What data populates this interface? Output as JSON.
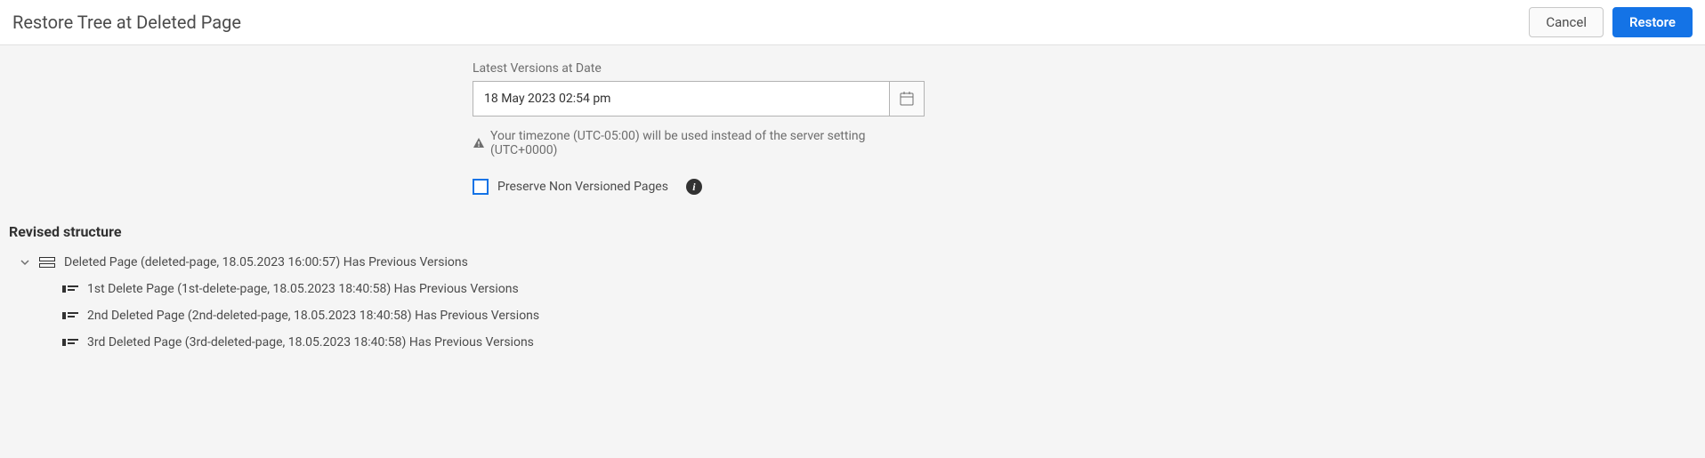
{
  "header": {
    "title": "Restore Tree at Deleted Page",
    "cancel_label": "Cancel",
    "restore_label": "Restore"
  },
  "form": {
    "date_label": "Latest Versions at Date",
    "date_value": "18 May 2023 02:54 pm",
    "timezone_note": "Your timezone (UTC-05:00) will be used instead of the server setting (UTC+0000)",
    "preserve_label": "Preserve Non Versioned Pages"
  },
  "section": {
    "title": "Revised structure"
  },
  "tree": {
    "root": {
      "label": "Deleted Page (deleted-page, 18.05.2023 16:00:57) Has Previous Versions"
    },
    "children": [
      {
        "label": "1st Delete Page (1st-delete-page, 18.05.2023 18:40:58) Has Previous Versions"
      },
      {
        "label": "2nd Deleted Page (2nd-deleted-page, 18.05.2023 18:40:58) Has Previous Versions"
      },
      {
        "label": "3rd Deleted Page (3rd-deleted-page, 18.05.2023 18:40:58) Has Previous Versions"
      }
    ]
  }
}
